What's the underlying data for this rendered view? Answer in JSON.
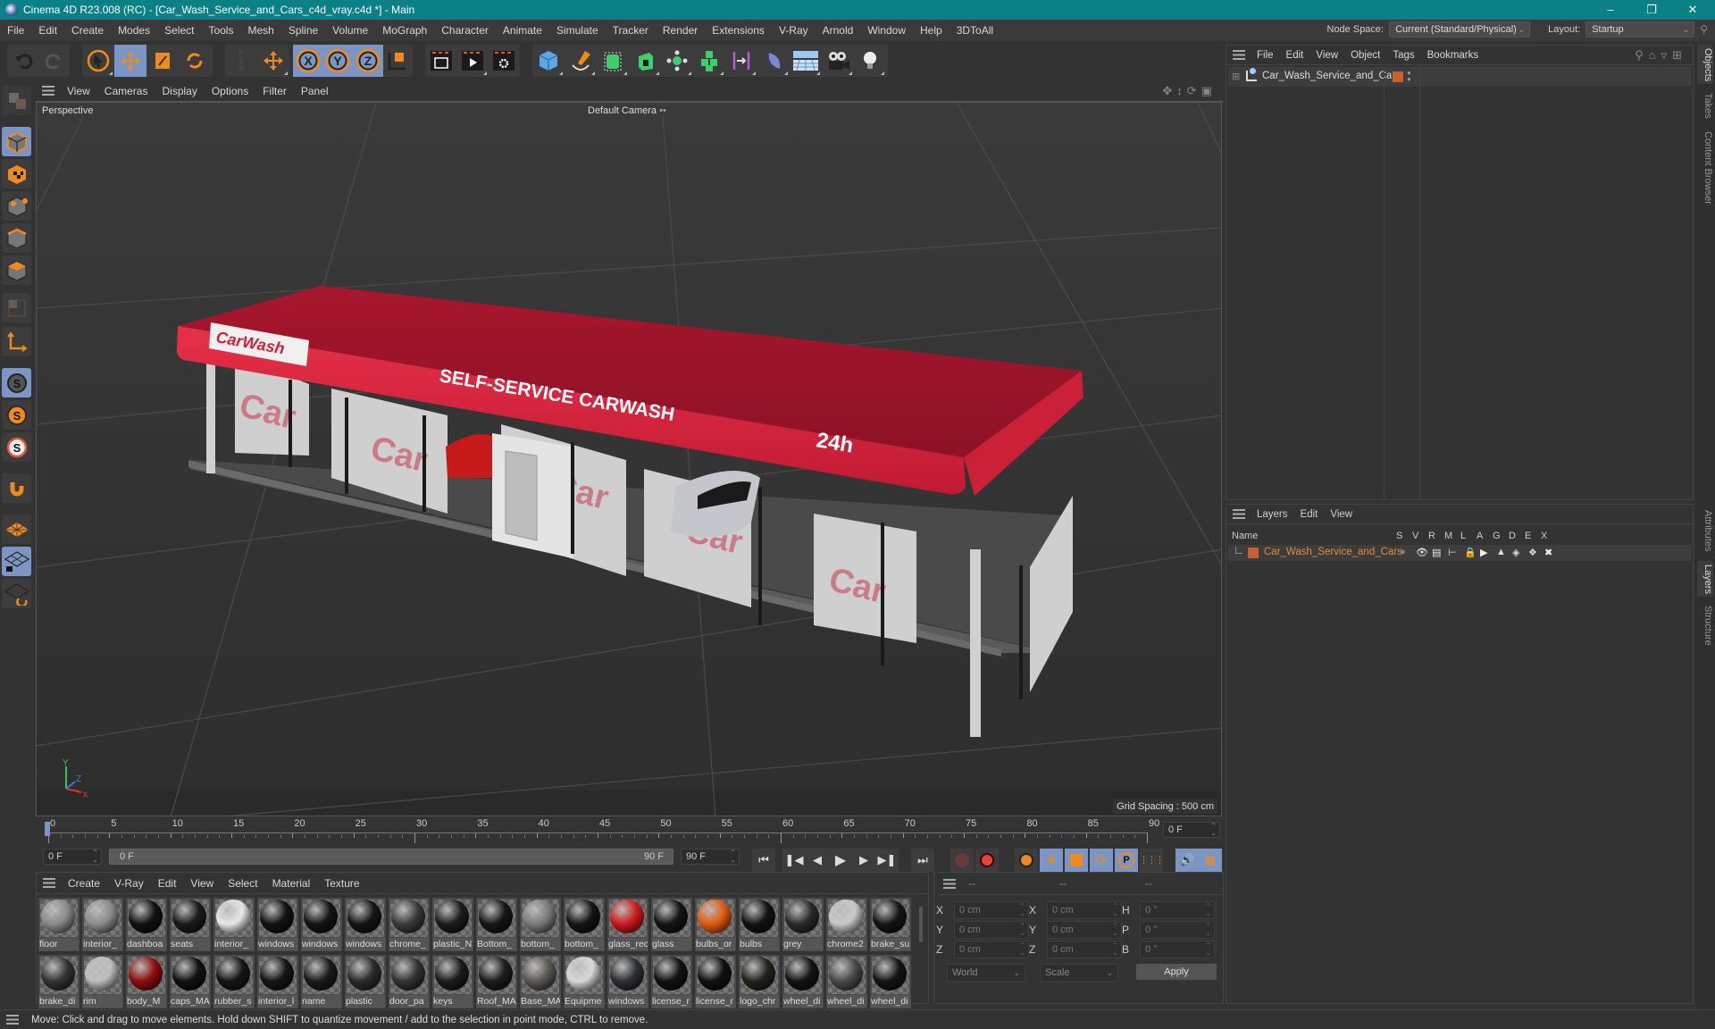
{
  "window": {
    "title": "Cinema 4D R23.008 (RC) - [Car_Wash_Service_and_Cars_c4d_vray.c4d *] - Main",
    "controls": [
      "minimize",
      "restore",
      "close"
    ]
  },
  "menubar": {
    "items": [
      "File",
      "Edit",
      "Create",
      "Modes",
      "Select",
      "Tools",
      "Mesh",
      "Spline",
      "Volume",
      "MoGraph",
      "Character",
      "Animate",
      "Simulate",
      "Tracker",
      "Render",
      "Extensions",
      "V-Ray",
      "Arnold",
      "Window",
      "Help",
      "3DToAll"
    ],
    "node_space_label": "Node Space:",
    "node_space_value": "Current (Standard/Physical)",
    "layout_label": "Layout:",
    "layout_value": "Startup"
  },
  "toolbar": {
    "groups": [
      [
        "undo-icon",
        "redo-icon"
      ],
      [
        "select-arrow-icon",
        "move-icon",
        "scale-icon",
        "rotate-icon"
      ],
      [
        "psr-icon",
        "move-axis-icon"
      ],
      [
        "x-axis-icon",
        "y-axis-icon",
        "z-axis-icon",
        "coordinate-system-icon"
      ],
      [
        "render-view-icon",
        "render-picture-viewer-icon",
        "render-settings-icon"
      ],
      [
        "cube-icon",
        "pen-icon",
        "subdivision-icon",
        "extrude-icon",
        "mograph-cloner-icon",
        "array-icon",
        "symmetry-icon",
        "deformer-icon",
        "floor-icon",
        "camera-icon",
        "light-icon"
      ]
    ],
    "active": [
      "move-icon",
      "x-axis-icon",
      "y-axis-icon",
      "z-axis-icon"
    ]
  },
  "left_toolbar": {
    "items": [
      "make-editable-icon",
      "model-mode-icon",
      "texture-mode-icon",
      "point-mode-icon",
      "edge-mode-icon",
      "polygon-mode-icon",
      "uv-mode-icon",
      "axis-mode-icon",
      "snap-icon",
      "snap-settings-icon",
      "soft-snap-icon",
      "magnet-icon",
      "workplane-icon",
      "locked-workplane-icon",
      "workplane-align-icon"
    ]
  },
  "viewport": {
    "menu": [
      "View",
      "Cameras",
      "Display",
      "Options",
      "Filter",
      "Panel"
    ],
    "projection": "Perspective",
    "camera": "Default Camera",
    "grid_spacing": "Grid Spacing : 500 cm",
    "scene": {
      "canopy_sign": "SELF-SERVICE CARWASH",
      "canopy_hours": "24h",
      "logo_text": "CarWash",
      "canopy_color": "#d41f3a"
    },
    "axis_labels": [
      "Y",
      "Z",
      "X"
    ]
  },
  "timeline": {
    "ticks": [
      "0",
      "5",
      "10",
      "15",
      "20",
      "25",
      "30",
      "35",
      "40",
      "45",
      "50",
      "55",
      "60",
      "65",
      "70",
      "75",
      "80",
      "85",
      "90"
    ],
    "current_frame": "0 F",
    "start_field": "0 F",
    "range_start": "0 F",
    "range_end": "90 F",
    "end_field": "90 F",
    "right_frame_field": "0 F"
  },
  "materials": {
    "menu": [
      "Create",
      "V-Ray",
      "Edit",
      "View",
      "Select",
      "Material",
      "Texture"
    ],
    "row1": [
      {
        "name": "floor",
        "color": "#8a8a8a"
      },
      {
        "name": "interior_",
        "color": "#8c8c8c"
      },
      {
        "name": "dashboa",
        "color": "#111111"
      },
      {
        "name": "seats",
        "color": "#1a1a1a"
      },
      {
        "name": "interior_",
        "color": "#e6e6e6"
      },
      {
        "name": "windows",
        "color": "#121212"
      },
      {
        "name": "windows",
        "color": "#141414"
      },
      {
        "name": "windows",
        "color": "#151515"
      },
      {
        "name": "chrome_",
        "color": "#3a3a3a"
      },
      {
        "name": "plastic_N",
        "color": "#1c1c1c"
      },
      {
        "name": "Bottom_",
        "color": "#161616"
      },
      {
        "name": "bottom_",
        "color": "#7a7a7a"
      },
      {
        "name": "bottom_",
        "color": "#141414"
      },
      {
        "name": "glass_rec",
        "color": "#cc1a1a"
      },
      {
        "name": "glass",
        "color": "#141414"
      },
      {
        "name": "bulbs_or",
        "color": "#e05a10"
      },
      {
        "name": "bulbs",
        "color": "#131313"
      },
      {
        "name": "grey",
        "color": "#2a2a2a"
      },
      {
        "name": "chrome2",
        "color": "#c8c8c8"
      },
      {
        "name": "brake_su",
        "color": "#151515"
      }
    ],
    "row2": [
      {
        "name": "brake_di",
        "color": "#333333"
      },
      {
        "name": "rim",
        "color": "#bdbdbd"
      },
      {
        "name": "body_M",
        "color": "#8e0c0c"
      },
      {
        "name": "caps_MA",
        "color": "#111111"
      },
      {
        "name": "rubber_s",
        "color": "#161616"
      },
      {
        "name": "interior_l",
        "color": "#151515"
      },
      {
        "name": "name",
        "color": "#1a1a1a"
      },
      {
        "name": "plastic",
        "color": "#2b2b2b"
      },
      {
        "name": "door_pa",
        "color": "#333333"
      },
      {
        "name": "keys",
        "color": "#1c1c1c"
      },
      {
        "name": "Roof_MA",
        "color": "#1c1c1c"
      },
      {
        "name": "Base_MA",
        "color": "#5b5853"
      },
      {
        "name": "Equipme",
        "color": "#d8d8d8"
      },
      {
        "name": "windows",
        "color": "#2c2f33"
      },
      {
        "name": "license_r",
        "color": "#111111"
      },
      {
        "name": "license_r",
        "color": "#111111"
      },
      {
        "name": "logo_chr",
        "color": "#22241a"
      },
      {
        "name": "wheel_di",
        "color": "#141414"
      },
      {
        "name": "wheel_di",
        "color": "#4a4a4a"
      },
      {
        "name": "wheel_di",
        "color": "#151515"
      }
    ]
  },
  "coordinates": {
    "headers": [
      "--",
      "--",
      "--"
    ],
    "position": [
      {
        "axis": "X",
        "value": "0 cm"
      },
      {
        "axis": "Y",
        "value": "0 cm"
      },
      {
        "axis": "Z",
        "value": "0 cm"
      }
    ],
    "size": [
      {
        "axis": "X",
        "value": "0 cm"
      },
      {
        "axis": "Y",
        "value": "0 cm"
      },
      {
        "axis": "Z",
        "value": "0 cm"
      }
    ],
    "rotation": [
      {
        "axis": "H",
        "value": "0 °"
      },
      {
        "axis": "P",
        "value": "0 °"
      },
      {
        "axis": "B",
        "value": "0 °"
      }
    ],
    "space": "World",
    "mode": "Scale",
    "apply": "Apply"
  },
  "objects_panel": {
    "menu": [
      "File",
      "Edit",
      "View",
      "Object",
      "Tags",
      "Bookmarks"
    ],
    "items": [
      {
        "name": "Car_Wash_Service_and_Cars",
        "layer_color": "#c8622a"
      }
    ]
  },
  "layers_panel": {
    "menu": [
      "Layers",
      "Edit",
      "View"
    ],
    "columns": [
      "Name",
      "S",
      "V",
      "R",
      "M",
      "L",
      "A",
      "G",
      "D",
      "E",
      "X"
    ],
    "items": [
      {
        "name": "Car_Wash_Service_and_Cars",
        "color": "#c8622a"
      }
    ]
  },
  "side_tabs": {
    "top": [
      "Objects",
      "Takes",
      "Content Browser"
    ],
    "bottom": [
      "Attributes",
      "Layers",
      "Structure"
    ],
    "active": [
      "Objects",
      "Layers"
    ]
  },
  "statusbar": {
    "text": "Move: Click and drag to move elements. Hold down SHIFT to quantize movement / add to the selection in point mode, CTRL to remove."
  }
}
